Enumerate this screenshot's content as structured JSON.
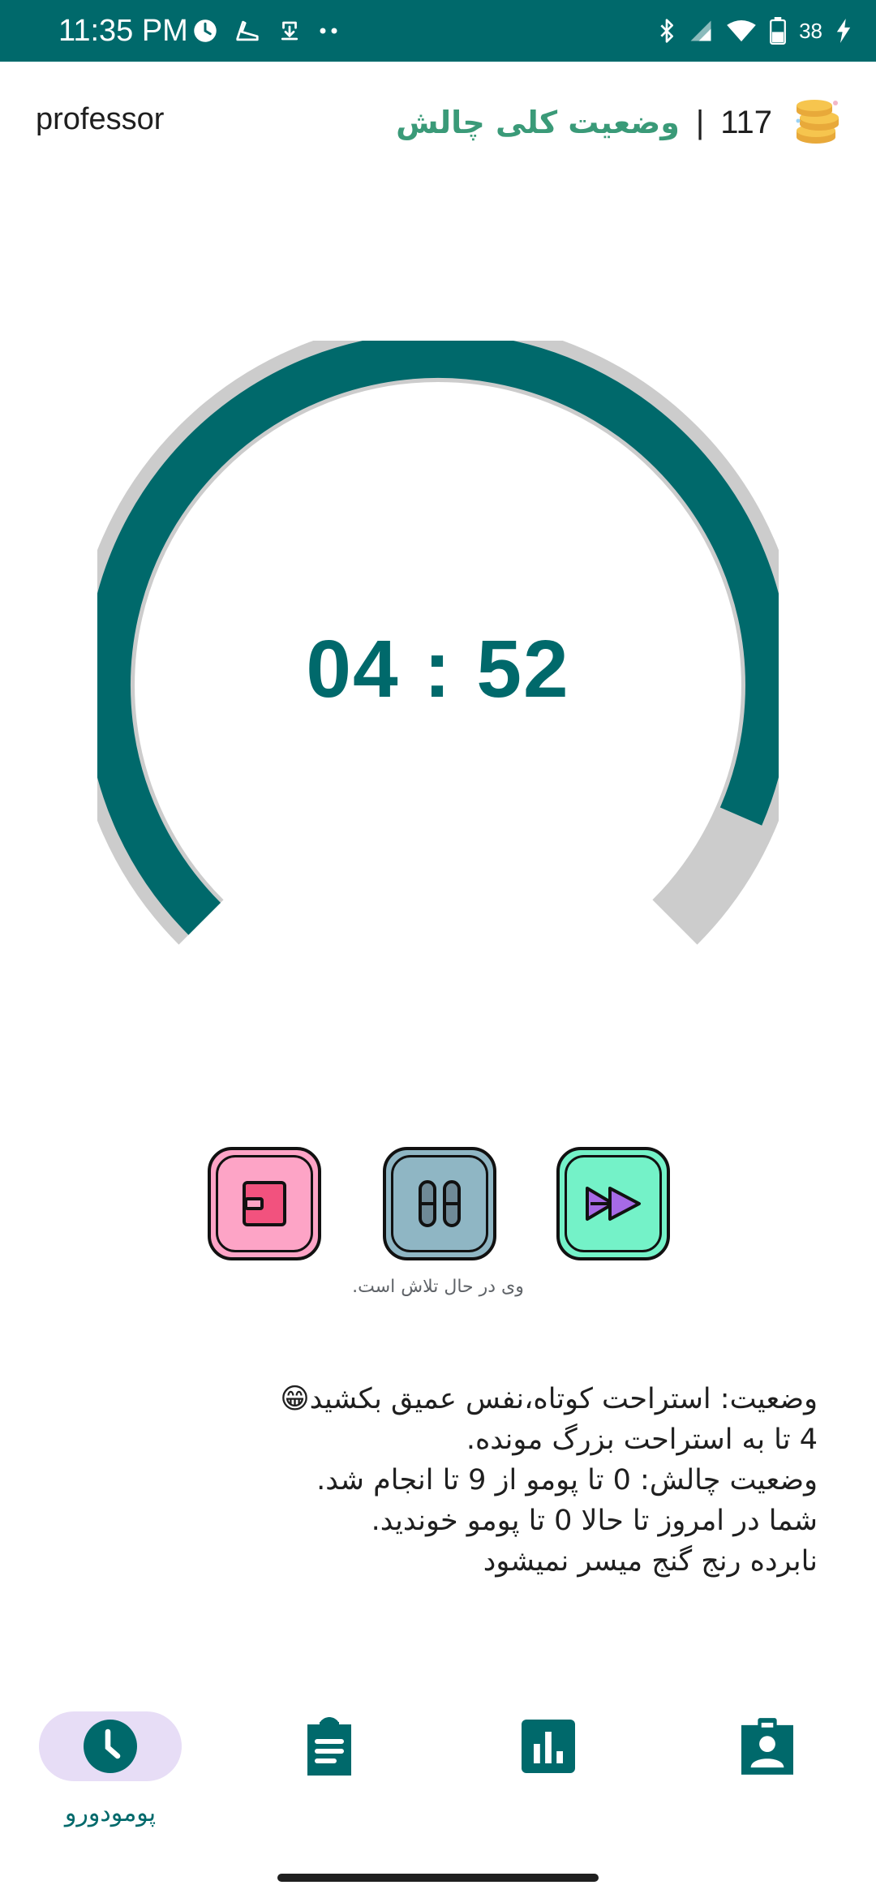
{
  "status_bar": {
    "time": "11:35 PM",
    "battery_level": "38",
    "left_icons": [
      "clock-icon",
      "shoe-icon",
      "cloud-download-icon",
      "more-dots-icon"
    ],
    "right_icons": [
      "bluetooth-icon",
      "cell-signal-icon",
      "wifi-icon",
      "battery-icon",
      "charging-icon"
    ]
  },
  "header": {
    "app_title": "professor",
    "challenge_link": "وضعیت کلی چالش",
    "separator": "|",
    "coin_count": "117",
    "coin_icon": "coins-icon"
  },
  "timer": {
    "display": "04 : 52",
    "progress": 0.92,
    "track_color": "#cccccc",
    "progress_color": "#00696b"
  },
  "controls": {
    "caption": "وی در حال تلاش است.",
    "buttons": [
      {
        "name": "stop",
        "icon": "stop-icon",
        "color": "#fda4c6"
      },
      {
        "name": "pause",
        "icon": "pause-icon",
        "color": "#8fb6c4"
      },
      {
        "name": "skip",
        "icon": "fast-forward-icon",
        "color": "#74f2c8"
      }
    ]
  },
  "status_text": {
    "line1": "وضعیت: استراحت کوتاه،نفس عمیق بکشید😁",
    "line2": "4 تا به استراحت بزرگ مونده.",
    "line3": "وضعیت چالش: 0 تا پومو از 9 تا انجام شد.",
    "line4": "شما در امروز تا حالا 0 تا پومو خوندید.",
    "line5": "نابرده رنج گنج میسر نمیشود"
  },
  "bottom_nav": {
    "items": [
      {
        "icon": "clock-icon",
        "label": "پومودورو",
        "active": true
      },
      {
        "icon": "clipboard-list-icon",
        "label": "",
        "active": false
      },
      {
        "icon": "bar-chart-icon",
        "label": "",
        "active": false
      },
      {
        "icon": "profile-badge-icon",
        "label": "",
        "active": false
      }
    ]
  },
  "colors": {
    "primary": "#00696b",
    "accent_green": "#3a9a78",
    "nav_active_bg": "#e7ddf6"
  }
}
